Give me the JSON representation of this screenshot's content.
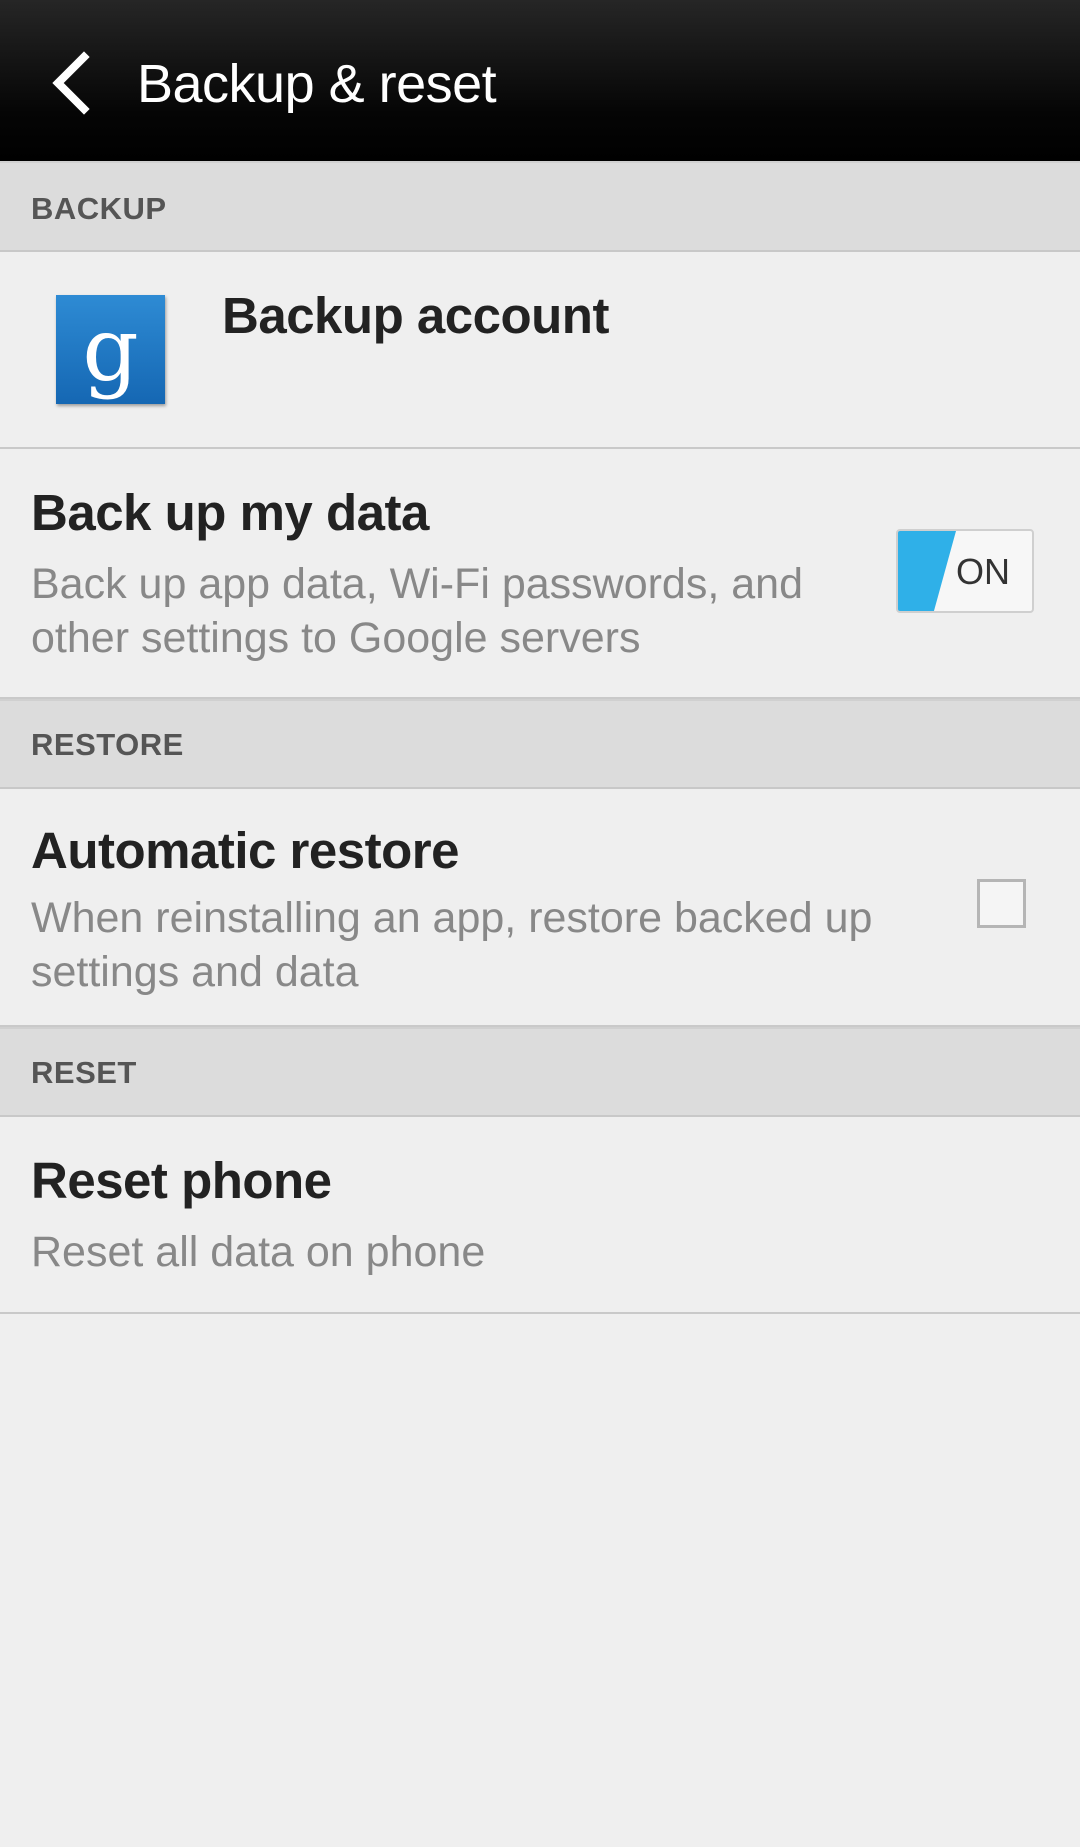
{
  "action_bar": {
    "title": "Backup & reset",
    "back_icon": "chevron-left-icon"
  },
  "sections": {
    "backup": "BACKUP",
    "restore": "RESTORE",
    "reset": "RESET"
  },
  "backup_account": {
    "title": "Backup account",
    "icon": "google-icon",
    "icon_glyph": "g",
    "icon_color": "#1e7ac4"
  },
  "back_up_my_data": {
    "title": "Back up my data",
    "summary_line1": "Back up app data, Wi-Fi passwords, and",
    "summary_line2": "other settings to Google servers",
    "toggle_state": "ON",
    "toggle_on": true,
    "accent_color": "#2fb0e8"
  },
  "automatic_restore": {
    "title": "Automatic restore",
    "summary_line1": "When reinstalling an app, restore backed up",
    "summary_line2": "settings and data",
    "checked": false
  },
  "reset_phone": {
    "title": "Reset phone",
    "summary": "Reset all data on phone"
  }
}
